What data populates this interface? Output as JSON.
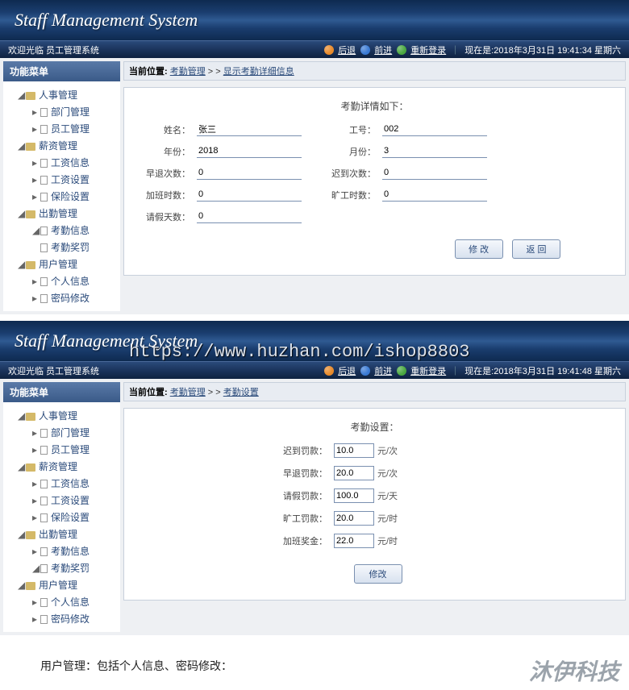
{
  "system_title": "Staff Management System",
  "topbar": {
    "welcome1": "欢迎光临 员工管理系统",
    "welcome2": "欢迎光临 员工管理系统",
    "back": "后退",
    "forward": "前进",
    "relogin": "重新登录",
    "time1": "现在是:2018年3月31日 19:41:34 星期六",
    "time2": "现在是:2018年3月31日 19:41:48 星期六"
  },
  "sidebar": {
    "title": "功能菜单",
    "hr": "人事管理",
    "hr_dept": "部门管理",
    "hr_emp": "员工管理",
    "salary": "薪资管理",
    "salary_wage": "工资信息",
    "salary_set": "工资设置",
    "salary_ins": "保险设置",
    "att": "出勤管理",
    "att_info": "考勤信息",
    "att_rp": "考勤奖罚",
    "user": "用户管理",
    "user_info": "个人信息",
    "user_pwd": "密码修改"
  },
  "breadcrumb1": {
    "label": "当前位置:",
    "cat": "考勤管理",
    "page": "显示考勤详细信息"
  },
  "breadcrumb2": {
    "label": "当前位置:",
    "cat": "考勤管理",
    "page": "考勤设置"
  },
  "form1": {
    "legend": "考勤详情如下：",
    "name_lbl": "姓名：",
    "name_val": "张三",
    "empno_lbl": "工号：",
    "empno_val": "002",
    "year_lbl": "年份：",
    "year_val": "2018",
    "month_lbl": "月份：",
    "month_val": "3",
    "early_lbl": "早退次数：",
    "early_val": "0",
    "late_lbl": "迟到次数：",
    "late_val": "0",
    "ot_lbl": "加班时数：",
    "ot_val": "0",
    "absent_lbl": "旷工时数：",
    "absent_val": "0",
    "leave_lbl": "请假天数：",
    "leave_val": "0",
    "btn_edit": "修 改",
    "btn_back": "返  回"
  },
  "form2": {
    "legend": "考勤设置：",
    "late_lbl": "迟到罚款：",
    "late_val": "10.0",
    "late_unit": "元/次",
    "early_lbl": "早退罚款：",
    "early_val": "20.0",
    "early_unit": "元/次",
    "leave_lbl": "请假罚款：",
    "leave_val": "100.0",
    "leave_unit": "元/天",
    "absent_lbl": "旷工罚款：",
    "absent_val": "20.0",
    "absent_unit": "元/时",
    "ot_lbl": "加班奖金：",
    "ot_val": "22.0",
    "ot_unit": "元/时",
    "btn_edit": "修改"
  },
  "url_overlay": "https://www.huzhan.com/ishop8803",
  "footer": "用户管理：包括个人信息、密码修改：",
  "watermark": "沐伊科技"
}
